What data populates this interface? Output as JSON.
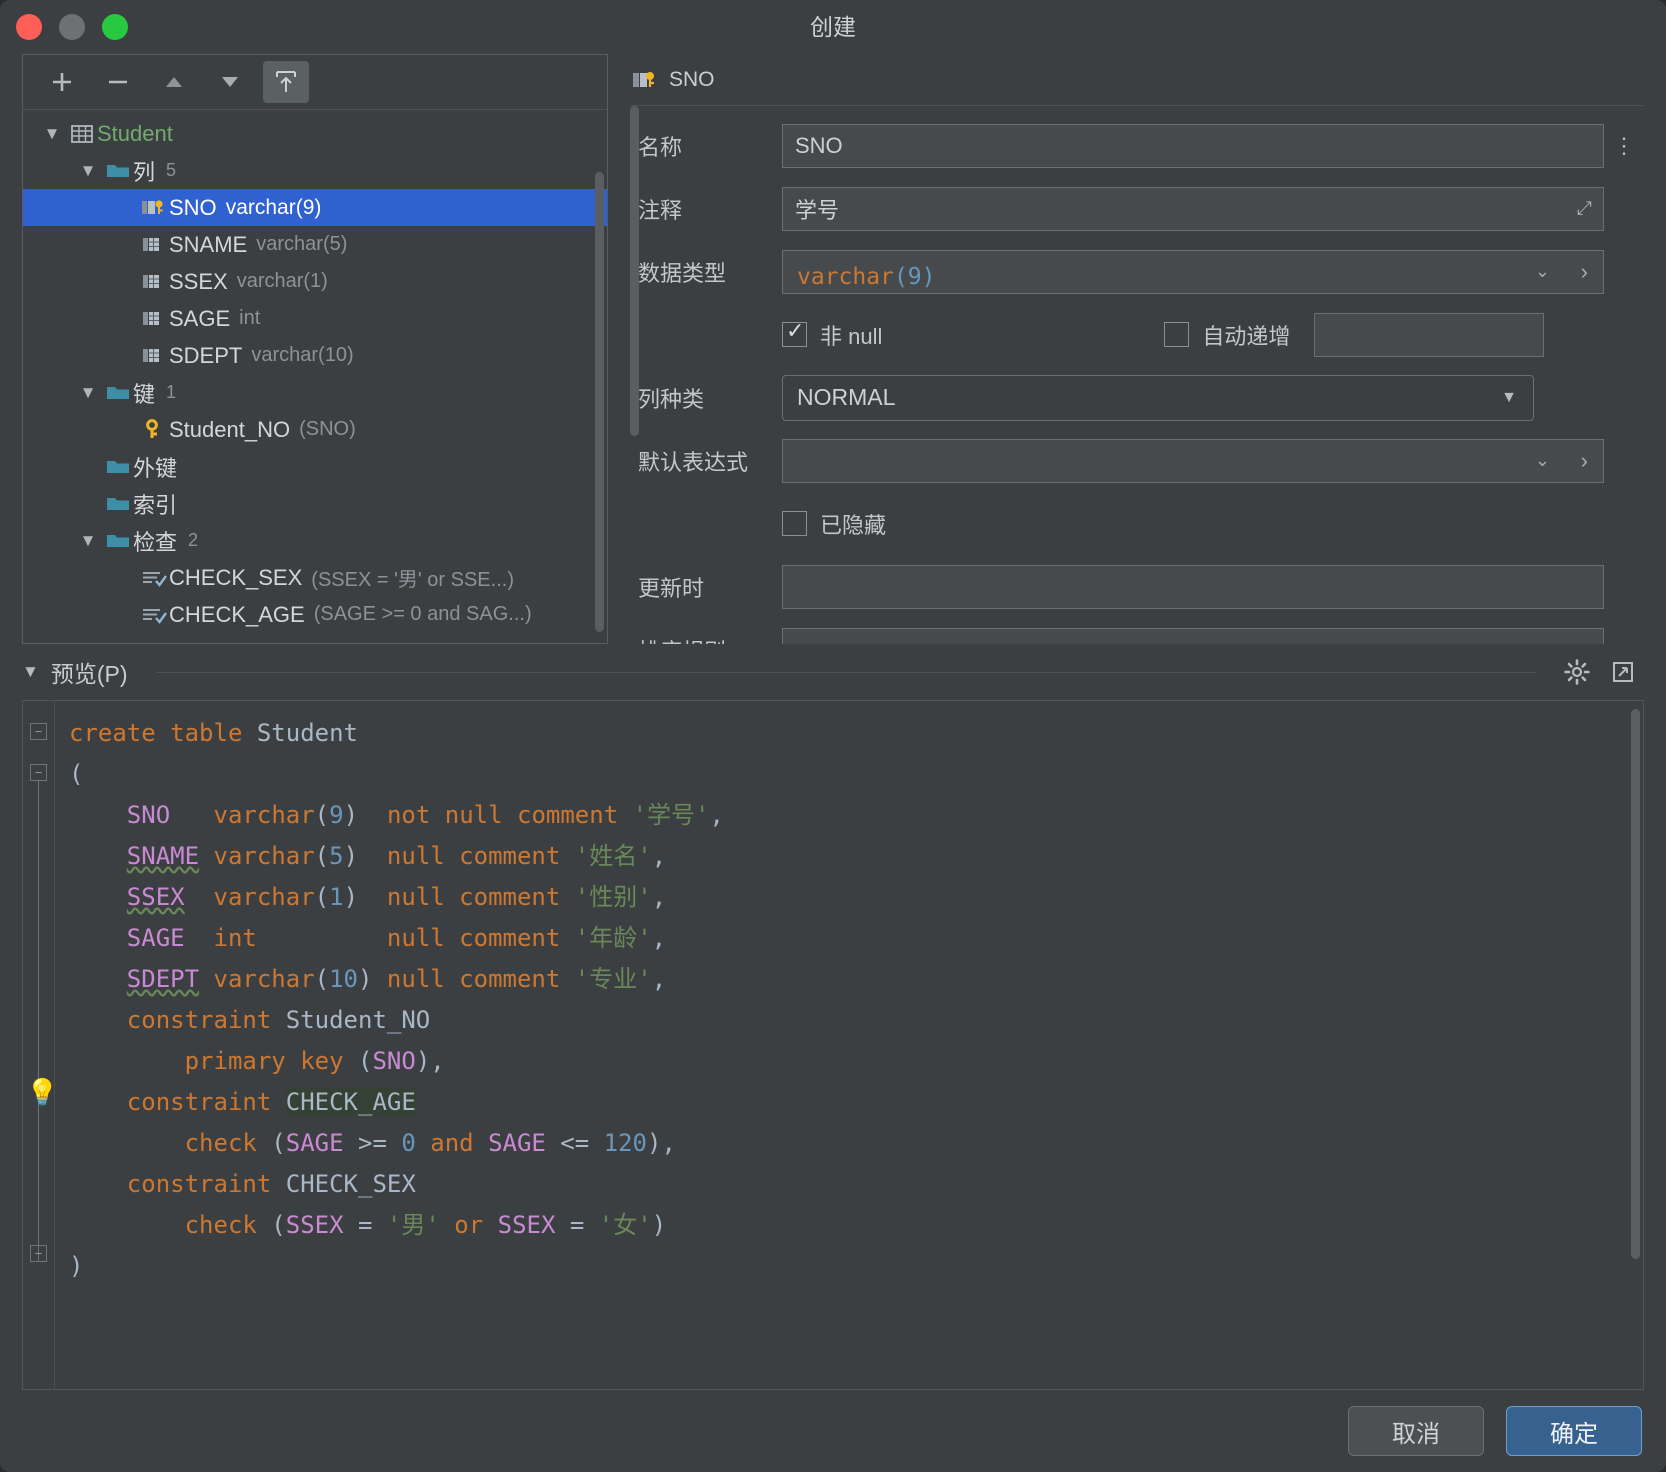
{
  "window": {
    "title": "创建"
  },
  "tree_toolbar": {
    "add": "+",
    "remove": "−",
    "up": "▲",
    "down": "▼",
    "export": "export-icon"
  },
  "tree": {
    "nodes": [
      {
        "label": "Student",
        "detail": "",
        "count": "",
        "icon": "table-icon",
        "indent": 0,
        "arrow": "▼",
        "style": "green",
        "selected": false
      },
      {
        "label": "列",
        "detail": "",
        "count": "5",
        "icon": "folder-icon",
        "indent": 1,
        "arrow": "▼",
        "style": "plain",
        "selected": false
      },
      {
        "label": "SNO",
        "detail": "varchar(9)",
        "count": "",
        "icon": "pk-column-icon",
        "indent": 2,
        "arrow": "",
        "style": "plain",
        "selected": true
      },
      {
        "label": "SNAME",
        "detail": "varchar(5)",
        "count": "",
        "icon": "column-icon",
        "indent": 2,
        "arrow": "",
        "style": "plain",
        "selected": false
      },
      {
        "label": "SSEX",
        "detail": "varchar(1)",
        "count": "",
        "icon": "column-icon",
        "indent": 2,
        "arrow": "",
        "style": "plain",
        "selected": false
      },
      {
        "label": "SAGE",
        "detail": "int",
        "count": "",
        "icon": "column-icon",
        "indent": 2,
        "arrow": "",
        "style": "plain",
        "selected": false
      },
      {
        "label": "SDEPT",
        "detail": "varchar(10)",
        "count": "",
        "icon": "column-icon",
        "indent": 2,
        "arrow": "",
        "style": "plain",
        "selected": false
      },
      {
        "label": "键",
        "detail": "",
        "count": "1",
        "icon": "folder-icon",
        "indent": 1,
        "arrow": "▼",
        "style": "plain",
        "selected": false
      },
      {
        "label": "Student_NO",
        "detail": "(SNO)",
        "count": "",
        "icon": "key-icon",
        "indent": 2,
        "arrow": "",
        "style": "plain",
        "selected": false
      },
      {
        "label": "外键",
        "detail": "",
        "count": "",
        "icon": "folder-icon",
        "indent": 1,
        "arrow": "",
        "style": "plain",
        "selected": false
      },
      {
        "label": "索引",
        "detail": "",
        "count": "",
        "icon": "folder-icon",
        "indent": 1,
        "arrow": "",
        "style": "plain",
        "selected": false
      },
      {
        "label": "检查",
        "detail": "",
        "count": "2",
        "icon": "folder-icon",
        "indent": 1,
        "arrow": "▼",
        "style": "plain",
        "selected": false
      },
      {
        "label": "CHECK_SEX",
        "detail": "(SSEX = '男' or SSE...)",
        "count": "",
        "icon": "check-icon",
        "indent": 2,
        "arrow": "",
        "style": "plain",
        "selected": false
      },
      {
        "label": "CHECK_AGE",
        "detail": "(SAGE >= 0 and SAG...)",
        "count": "",
        "icon": "check-icon",
        "indent": 2,
        "arrow": "",
        "style": "plain",
        "selected": false
      }
    ]
  },
  "form": {
    "header_title": "SNO",
    "name_label": "名称",
    "name_value": "SNO",
    "comment_label": "注释",
    "comment_value": "学号",
    "datatype_label": "数据类型",
    "datatype_value_type": "varchar",
    "datatype_value_len": "(9)",
    "notnull_label": "非 null",
    "autoinc_label": "自动递增",
    "autoinc_value": "",
    "colkind_label": "列种类",
    "colkind_value": "NORMAL",
    "default_label": "默认表达式",
    "default_value": "",
    "hidden_label": "已隐藏",
    "onupdate_label": "更新时",
    "onupdate_value": "",
    "collation_label": "排序规则"
  },
  "preview": {
    "title": "预览(P)",
    "collapse_arrow": "▼",
    "settings_icon": "gear-icon",
    "expand_icon": "expand-icon"
  },
  "sql": {
    "lines": [
      "create table Student",
      "(",
      "    SNO   varchar(9)  not null comment '学号',",
      "    SNAME varchar(5)  null comment '姓名',",
      "    SSEX  varchar(1)  null comment '性别',",
      "    SAGE  int         null comment '年龄',",
      "    SDEPT varchar(10) null comment '专业',",
      "    constraint Student_NO",
      "        primary key (SNO),",
      "    constraint CHECK_AGE",
      "        check (SAGE >= 0 and SAGE <= 120),",
      "    constraint CHECK_SEX",
      "        check (SSEX = '男' or SSEX = '女')",
      ")"
    ]
  },
  "footer": {
    "cancel_label": "取消",
    "ok_label": "确定"
  },
  "colors": {
    "accent": "#2f62d0",
    "primary_button": "#37618f",
    "keyword": "#cc7832",
    "string": "#6a8759",
    "number": "#6897bb",
    "column": "#c98ad4",
    "table_name": "#6fad6b"
  }
}
